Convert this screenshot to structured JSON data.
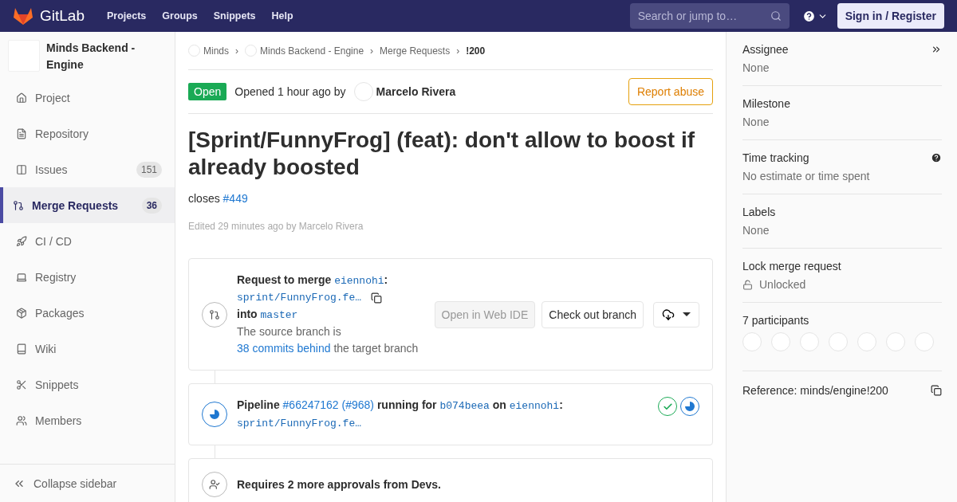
{
  "navbar": {
    "logo_text": "GitLab",
    "links": [
      "Projects",
      "Groups",
      "Snippets",
      "Help"
    ],
    "search": {
      "placeholder": "Search or jump to…"
    },
    "sign_in": "Sign in / Register"
  },
  "sidebar": {
    "project_name": "Minds Backend - Engine",
    "items": [
      {
        "label": "Project",
        "selected": false
      },
      {
        "label": "Repository",
        "selected": false
      },
      {
        "label": "Issues",
        "count": "151",
        "selected": false
      },
      {
        "label": "Merge Requests",
        "count": "36",
        "selected": true
      },
      {
        "label": "CI / CD",
        "selected": false
      },
      {
        "label": "Registry",
        "selected": false
      },
      {
        "label": "Packages",
        "selected": false
      },
      {
        "label": "Wiki",
        "selected": false
      },
      {
        "label": "Snippets",
        "selected": false
      },
      {
        "label": "Members",
        "selected": false
      }
    ],
    "collapse": "Collapse sidebar"
  },
  "breadcrumbs": [
    {
      "label": "Minds",
      "has_avatar": true,
      "current": false
    },
    {
      "label": "Minds Backend - Engine",
      "has_avatar": true,
      "current": false
    },
    {
      "label": "Merge Requests",
      "has_avatar": false,
      "current": false
    },
    {
      "label": "!200",
      "has_avatar": false,
      "current": true
    }
  ],
  "breadcrumb_separator": "›",
  "header": {
    "status": "Open",
    "opened_text": "Opened 1 hour ago by",
    "author": "Marcelo Rivera",
    "report_button": "Report abuse"
  },
  "title": "[Sprint/FunnyFrog] (feat): don't allow to boost if already boosted",
  "description": {
    "text": "closes",
    "link": "#449"
  },
  "edited": "Edited 29 minutes ago by Marcelo Rivera",
  "merge_widget": {
    "request_text": "Request to merge",
    "source_namespace": "eiennohi",
    "colon": ":",
    "source_branch": "sprint/FunnyFrog.fe…",
    "into_text": "into",
    "target_branch": "master",
    "behind_prefix": "The source branch is",
    "behind_link": "38 commits behind",
    "behind_suffix": "the target branch",
    "buttons": [
      {
        "label": "Open in Web IDE",
        "disabled": true
      },
      {
        "label": "Check out branch",
        "disabled": false
      }
    ]
  },
  "pipeline": {
    "label": "Pipeline",
    "link": "#66247162 (#968)",
    "running_for": "running for",
    "commit": "b074beea",
    "on_text": "on",
    "namespace": "eiennohi",
    "colon": ":",
    "branch": "sprint/FunnyFrog.fe…",
    "stages": [
      {
        "kind": "success"
      },
      {
        "kind": "running"
      }
    ]
  },
  "approvals": {
    "text": "Requires 2 more approvals from Devs."
  },
  "right_sidebar": {
    "blocks": [
      {
        "title": "Assignee",
        "value": "None"
      },
      {
        "title": "Milestone",
        "value": "None"
      },
      {
        "title": "Time tracking",
        "value": "No estimate or time spent"
      },
      {
        "title": "Labels",
        "value": "None"
      },
      {
        "title": "Lock merge request",
        "value": "Unlocked"
      }
    ],
    "participants": {
      "title": "7 participants",
      "avatars": [
        {
          "kind": "blank"
        },
        {
          "kind": "blank"
        },
        {
          "kind": "blank"
        },
        {
          "kind": "blank"
        },
        {
          "kind": "blank"
        },
        {
          "kind": "blank"
        },
        {
          "kind": "blank"
        }
      ]
    },
    "reference": "Reference: minds/engine!200"
  }
}
